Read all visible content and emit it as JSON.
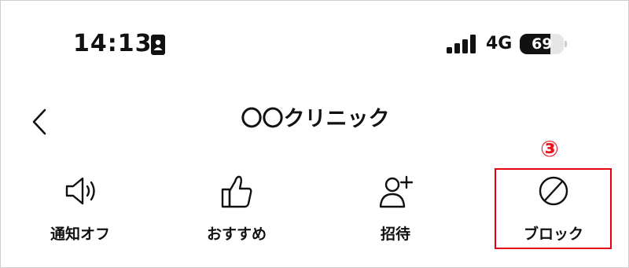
{
  "status_bar": {
    "time": "14:13",
    "network": "4G",
    "battery_level": 69,
    "battery_label": "69",
    "icons": [
      "portrait-lock-icon",
      "signal-bars-icon",
      "battery-icon"
    ]
  },
  "nav": {
    "back_icon": "chevron-left-icon",
    "title": "〇〇クリニック"
  },
  "annotation": {
    "step": "③",
    "color": "#e60012"
  },
  "actions": [
    {
      "label": "通知オフ",
      "icon": "speaker-icon"
    },
    {
      "label": "おすすめ",
      "icon": "thumbs-up-icon"
    },
    {
      "label": "招待",
      "icon": "add-person-icon"
    },
    {
      "label": "ブロック",
      "icon": "block-icon"
    }
  ]
}
